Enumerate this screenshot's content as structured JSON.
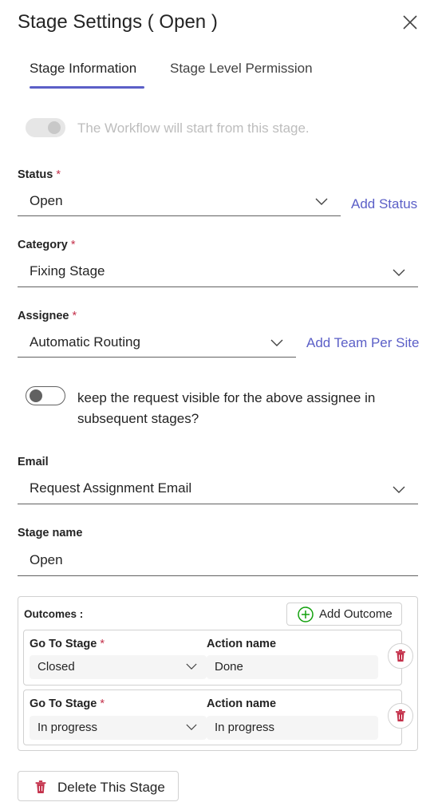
{
  "header": {
    "title": "Stage Settings ( Open )",
    "close_icon": "close-icon"
  },
  "tabs": [
    {
      "label": "Stage Information",
      "active": true
    },
    {
      "label": "Stage Level Permission",
      "active": false
    }
  ],
  "workflow_start": {
    "text": "The Workflow will start from this stage.",
    "enabled": false,
    "checked": true
  },
  "status": {
    "label": "Status",
    "required_mark": "*",
    "value": "Open",
    "link": "Add Status"
  },
  "category": {
    "label": "Category",
    "required_mark": "*",
    "value": "Fixing Stage"
  },
  "assignee": {
    "label": "Assignee",
    "required_mark": "*",
    "value": "Automatic Routing",
    "link": "Add Team Per Site"
  },
  "keep_visible": {
    "text": "keep the request visible for the above assignee in subsequent stages?",
    "checked": false
  },
  "email": {
    "label": "Email",
    "value": "Request Assignment Email"
  },
  "stage_name": {
    "label": "Stage name",
    "value": "Open"
  },
  "outcomes": {
    "label": "Outcomes :",
    "add_label": "Add Outcome",
    "go_to_label": "Go To Stage",
    "required_mark": "*",
    "action_label": "Action name",
    "rows": [
      {
        "stage": "Closed",
        "action": "Done"
      },
      {
        "stage": "In progress",
        "action": "In progress"
      }
    ]
  },
  "delete_stage": {
    "label": "Delete This Stage"
  },
  "colors": {
    "accent": "#5b5fc7",
    "required": "#c4314b",
    "delete": "#c4314b",
    "add_outcome": "#13a10e"
  }
}
